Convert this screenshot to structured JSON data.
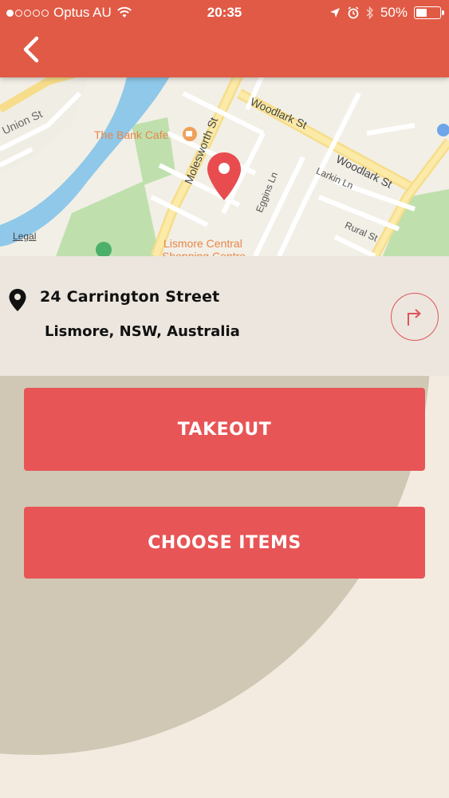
{
  "status_bar": {
    "carrier": "Optus AU",
    "time": "20:35",
    "battery": "50%",
    "battery_level": 0.5
  },
  "map": {
    "labels": {
      "union_st": "Union St",
      "bank_cafe": "The Bank Cafe",
      "molesworth_st": "Molesworth St",
      "woodlark_st_1": "Woodlark St",
      "woodlark_st_2": "Woodlark St",
      "eggins_ln": "Eggins Ln",
      "larkin_ln": "Larkin Ln",
      "rural_st": "Rural St",
      "lismore_central": "Lismore Central",
      "shopping_centre": "Shopping Centre",
      "legal": "Legal"
    }
  },
  "address": {
    "line1": "24 Carrington Street",
    "line2": "Lismore, NSW, Australia"
  },
  "buttons": {
    "takeout": "TAKEOUT",
    "choose_items": "CHOOSE ITEMS"
  },
  "colors": {
    "header": "#e05a45",
    "button": "#e85556",
    "pin": "#e84c4f"
  }
}
